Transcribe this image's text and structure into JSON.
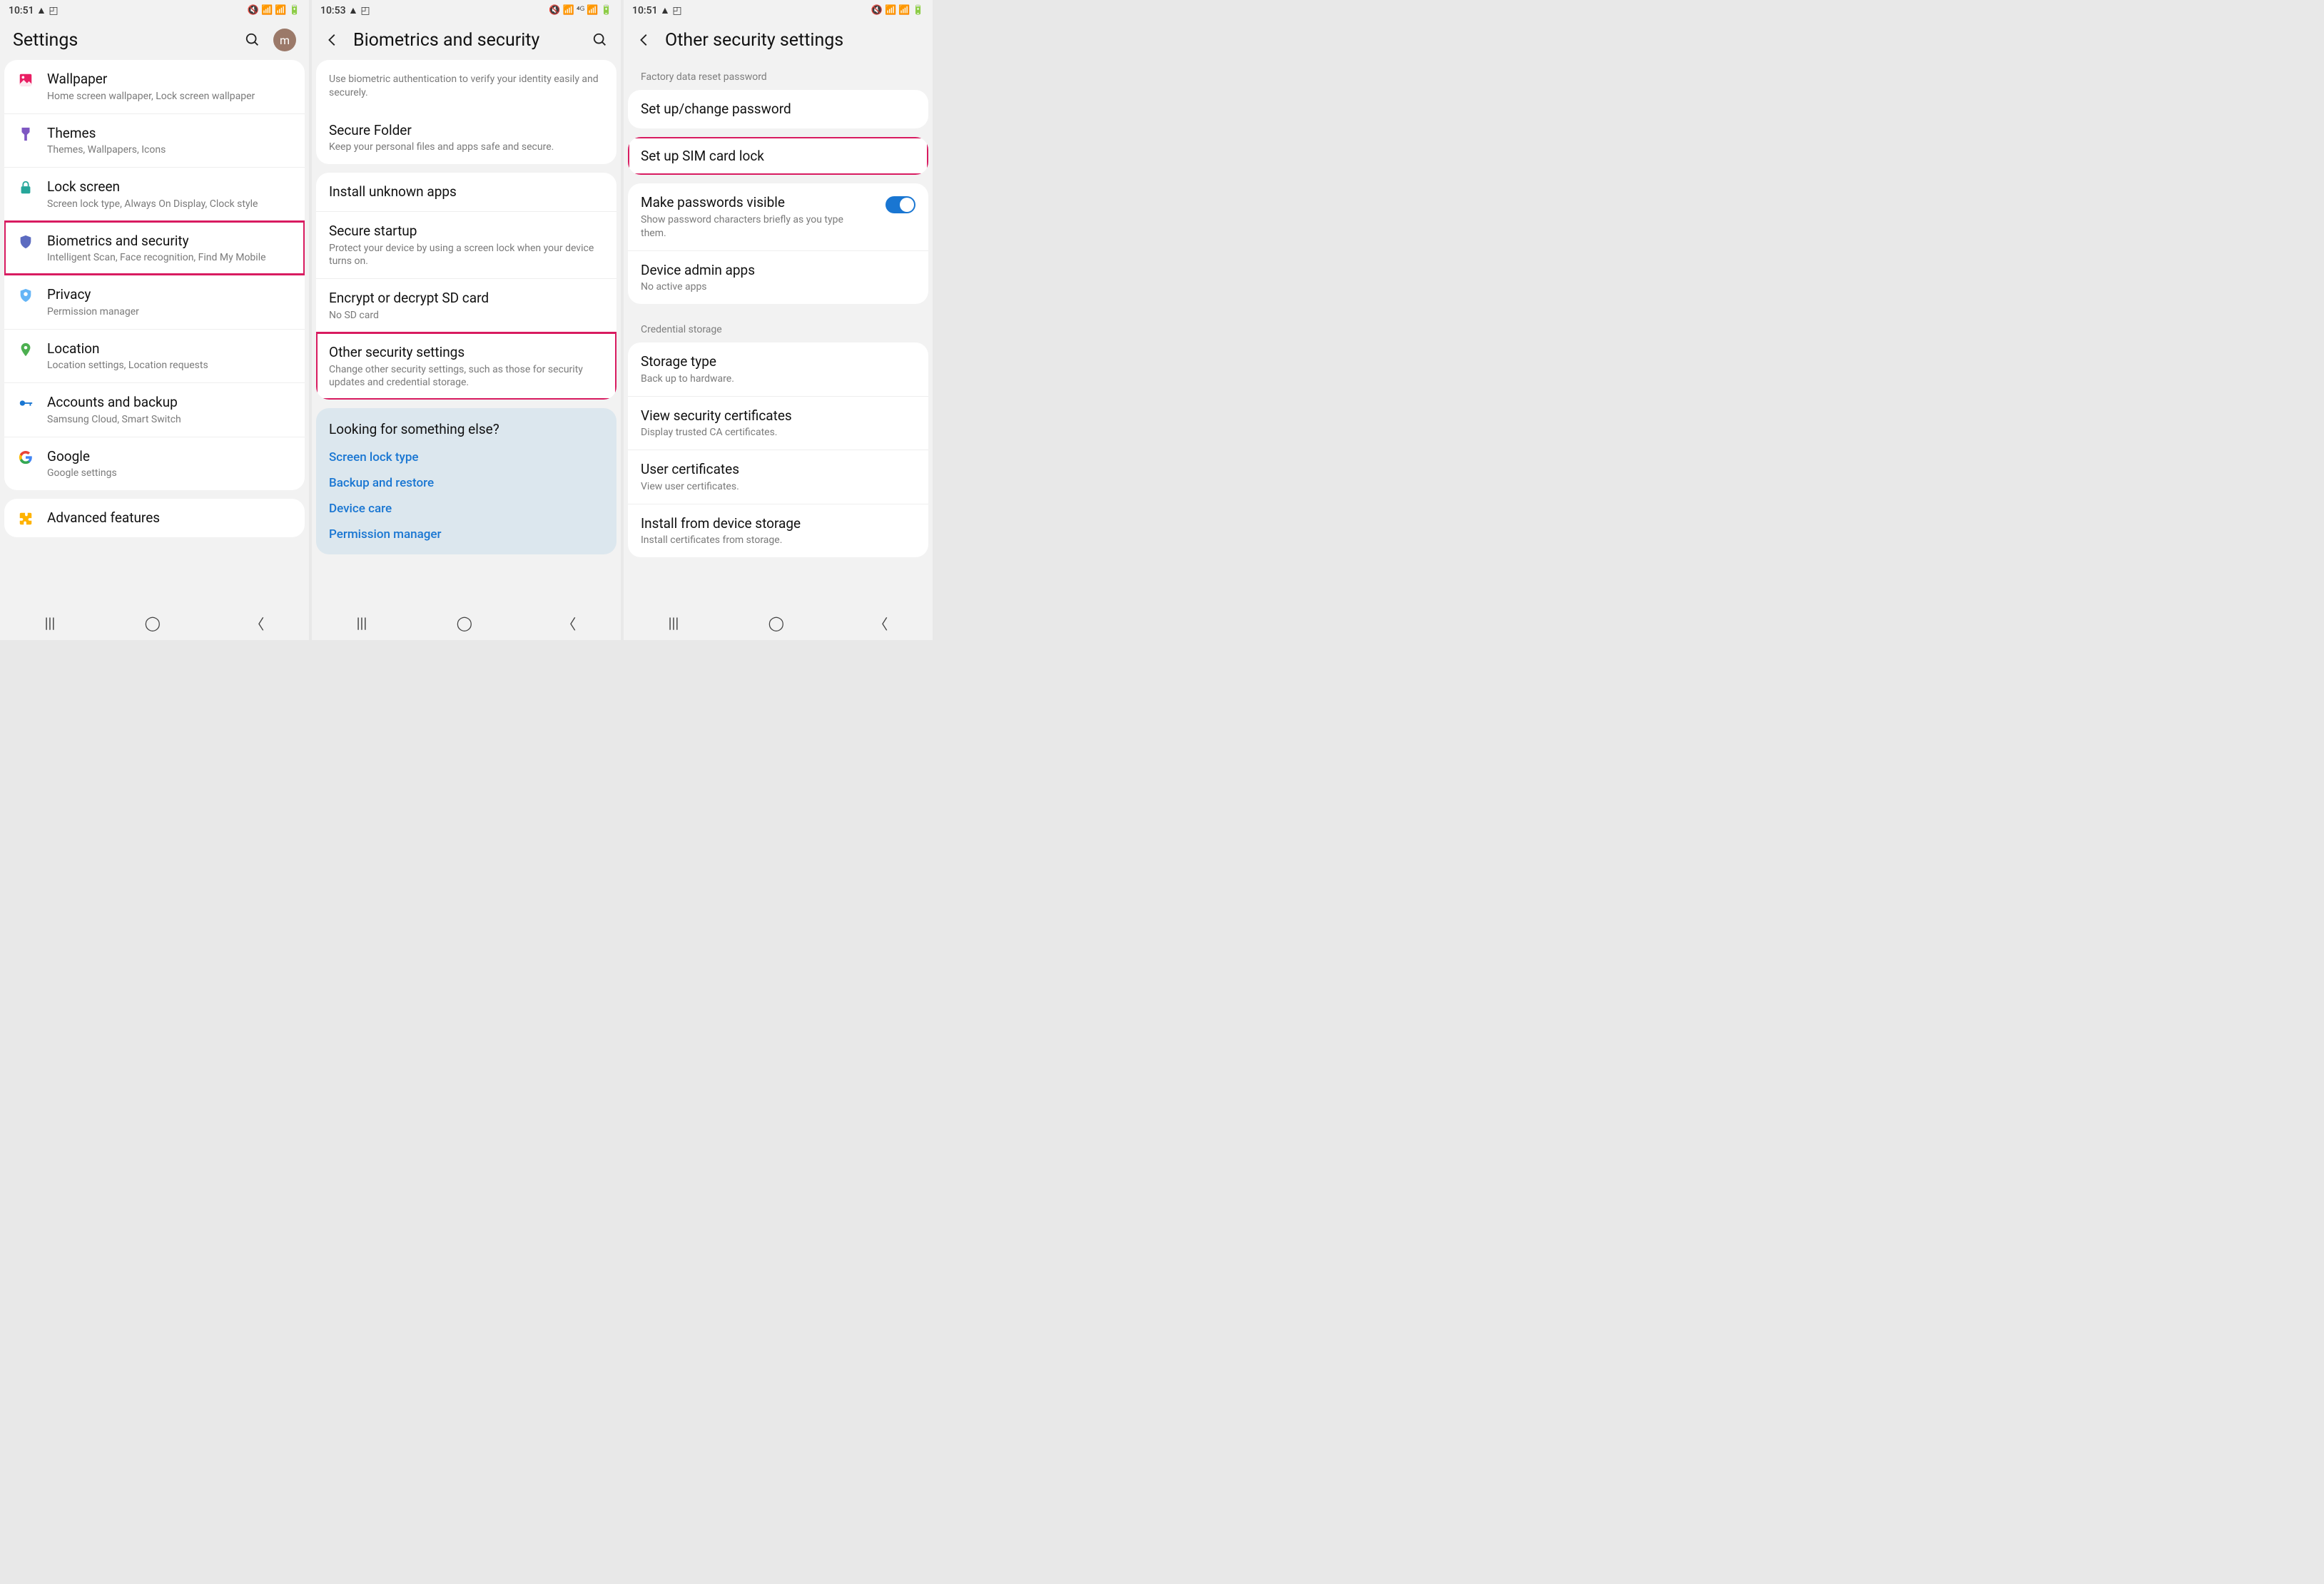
{
  "screens": {
    "settings": {
      "time": "10:51",
      "title": "Settings",
      "avatar_letter": "m",
      "items": [
        {
          "icon": "wallpaper",
          "title": "Wallpaper",
          "sub": "Home screen wallpaper, Lock screen wallpaper",
          "color": "#e91e63"
        },
        {
          "icon": "themes",
          "title": "Themes",
          "sub": "Themes, Wallpapers, Icons",
          "color": "#7e57c2"
        },
        {
          "icon": "lock",
          "title": "Lock screen",
          "sub": "Screen lock type, Always On Display, Clock style",
          "color": "#26a69a"
        },
        {
          "icon": "shield",
          "title": "Biometrics and security",
          "sub": "Intelligent Scan, Face recognition, Find My Mobile",
          "color": "#5c6bc0",
          "highlight": true
        },
        {
          "icon": "shield-outline",
          "title": "Privacy",
          "sub": "Permission manager",
          "color": "#64b5f6"
        },
        {
          "icon": "pin",
          "title": "Location",
          "sub": "Location settings, Location requests",
          "color": "#4caf50"
        },
        {
          "icon": "key",
          "title": "Accounts and backup",
          "sub": "Samsung Cloud, Smart Switch",
          "color": "#1976d2"
        },
        {
          "icon": "google",
          "title": "Google",
          "sub": "Google settings",
          "color": "#4285F4"
        },
        {
          "icon": "puzzle",
          "title": "Advanced features",
          "sub": "",
          "color": "#ffb300"
        }
      ]
    },
    "biometrics": {
      "time": "10:53",
      "title": "Biometrics and security",
      "intro_sub": "Use biometric authentication to verify your identity easily and securely.",
      "items1": [
        {
          "title": "Secure Folder",
          "sub": "Keep your personal files and apps safe and secure."
        }
      ],
      "items2": [
        {
          "title": "Install unknown apps",
          "sub": ""
        },
        {
          "title": "Secure startup",
          "sub": "Protect your device by using a screen lock when your device turns on."
        },
        {
          "title": "Encrypt or decrypt SD card",
          "sub": "No SD card"
        },
        {
          "title": "Other security settings",
          "sub": "Change other security settings, such as those for security updates and credential storage.",
          "highlight": true
        }
      ],
      "suggest_title": "Looking for something else?",
      "suggest_links": [
        "Screen lock type",
        "Backup and restore",
        "Device care",
        "Permission manager"
      ]
    },
    "other": {
      "time": "10:51",
      "title": "Other security settings",
      "header1": "Factory data reset password",
      "items1": [
        {
          "title": "Set up/change password",
          "sub": ""
        }
      ],
      "items2": [
        {
          "title": "Set up SIM card lock",
          "sub": "",
          "highlight": true
        }
      ],
      "items3": [
        {
          "title": "Make passwords visible",
          "sub": "Show password characters briefly as you type them.",
          "toggle": true
        },
        {
          "title": "Device admin apps",
          "sub": "No active apps"
        }
      ],
      "header2": "Credential storage",
      "items4": [
        {
          "title": "Storage type",
          "sub": "Back up to hardware."
        },
        {
          "title": "View security certificates",
          "sub": "Display trusted CA certificates."
        },
        {
          "title": "User certificates",
          "sub": "View user certificates."
        },
        {
          "title": "Install from device storage",
          "sub": "Install certificates from storage."
        }
      ]
    }
  },
  "status_icons_text": "▲ ◰"
}
